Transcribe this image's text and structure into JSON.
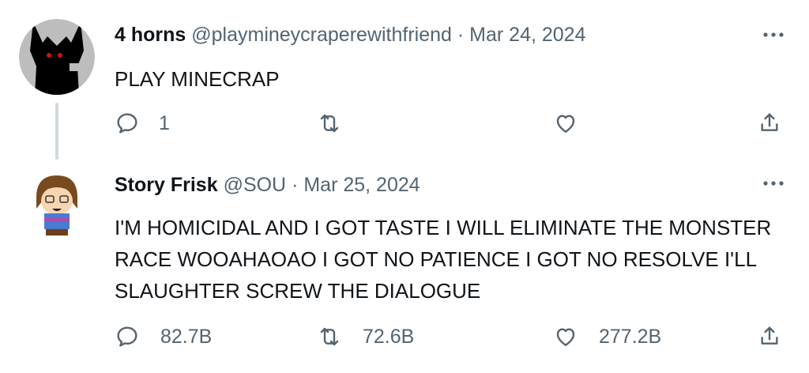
{
  "tweets": [
    {
      "name": "4 horns",
      "handle": "@playmineycraperewithfriend",
      "sep": "·",
      "date": "Mar 24, 2024",
      "text": "PLAY MINECRAP",
      "reply_count": "1",
      "retweet_count": "",
      "like_count": "",
      "avatar_icon": "dark-creature-avatar-icon"
    },
    {
      "name": "Story Frisk",
      "handle": "@SOU",
      "sep": "·",
      "date": "Mar 25, 2024",
      "text": "I'M HOMICIDAL AND I GOT TASTE I WILL ELIMINATE THE MONSTER RACE WOOAHAOAO I GOT NO PATIENCE I GOT NO RESOLVE I'LL SLAUGHTER SCREW THE DIALOGUE",
      "reply_count": "82.7B",
      "retweet_count": "72.6B",
      "like_count": "277.2B",
      "avatar_icon": "frisk-character-avatar-icon"
    }
  ],
  "colors": {
    "text": "#0f1419",
    "muted": "#536471",
    "thread": "#cfd9de"
  }
}
